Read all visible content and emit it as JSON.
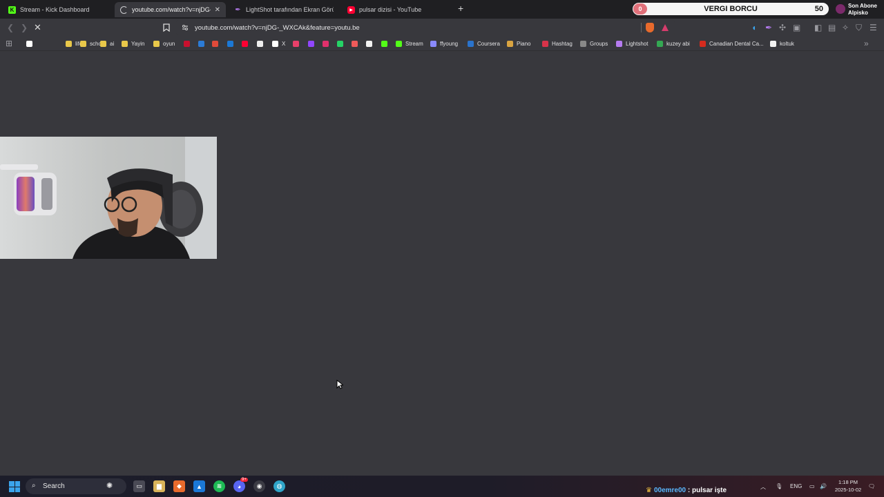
{
  "tabs": [
    {
      "title": "Stream - Kick Dashboard",
      "favicon": "kick-icon",
      "color": "#53fc18"
    },
    {
      "title": "youtube.com/watch?v=njDG-_W",
      "favicon": "loading-icon",
      "color": "#cfcfd2"
    },
    {
      "title": "LightShot tarafından Ekran Görüntüsü",
      "favicon": "lightshot-icon",
      "color": "#b57bf0"
    },
    {
      "title": "pulsar dizisi - YouTube",
      "favicon": "youtube-icon",
      "color": "#ff0033"
    }
  ],
  "new_tab_label": "+",
  "overlay": {
    "vergi_start": "0",
    "vergi_title": "VERGI BORCU",
    "vergi_end": "50",
    "abone_line1": "Son Abone",
    "abone_line2": "Alpisko"
  },
  "address_bar": {
    "url": "youtube.com/watch?v=njDG-_WXCAk&feature=youtu.be"
  },
  "bookmarks": [
    {
      "label": "",
      "icon": "google-icon",
      "color": "#ffffff"
    },
    {
      "label": "life",
      "icon": "folder-icon",
      "color": "#e9c84a"
    },
    {
      "label": "school",
      "icon": "folder-icon",
      "color": "#e9c84a"
    },
    {
      "label": "ai",
      "icon": "folder-icon",
      "color": "#e9c84a"
    },
    {
      "label": "Yayin",
      "icon": "folder-icon",
      "color": "#e9c84a"
    },
    {
      "label": "oyun",
      "icon": "folder-icon",
      "color": "#e9c84a"
    },
    {
      "label": "",
      "icon": "pinterest-icon",
      "color": "#c8102e"
    },
    {
      "label": "",
      "icon": "linkedin-icon",
      "color": "#2b7bd6"
    },
    {
      "label": "",
      "icon": "gmail-icon",
      "color": "#e04a3a"
    },
    {
      "label": "",
      "icon": "outlook-icon",
      "color": "#1b78d6"
    },
    {
      "label": "",
      "icon": "youtube-icon",
      "color": "#ff0033"
    },
    {
      "label": "",
      "icon": "grammarly-icon",
      "color": "#eeeeee"
    },
    {
      "label": "X",
      "icon": "x-icon",
      "color": "#ffffff"
    },
    {
      "label": "",
      "icon": "pocket-icon",
      "color": "#e8406a"
    },
    {
      "label": "",
      "icon": "twitch-icon",
      "color": "#9146ff"
    },
    {
      "label": "",
      "icon": "instagram-icon",
      "color": "#e1306c"
    },
    {
      "label": "",
      "icon": "whatsapp-icon",
      "color": "#25d366"
    },
    {
      "label": "",
      "icon": "tumblr-icon",
      "color": "#ef5a5a"
    },
    {
      "label": "",
      "icon": "amazon-icon",
      "color": "#f2f2f2"
    },
    {
      "label": "",
      "icon": "kick-icon",
      "color": "#53fc18"
    },
    {
      "label": "Stream",
      "icon": "kick-icon",
      "color": "#53fc18"
    },
    {
      "label": "ffyoung",
      "icon": "link-icon",
      "color": "#8a8aff"
    },
    {
      "label": "Coursera",
      "icon": "coursera-icon",
      "color": "#2a73cc"
    },
    {
      "label": "Piano",
      "icon": "piano-icon",
      "color": "#d9a441"
    },
    {
      "label": "Hashtag",
      "icon": "hashtag-icon",
      "color": "#d8334a"
    },
    {
      "label": "Groups",
      "icon": "chain-icon",
      "color": "#888888"
    },
    {
      "label": "Lightshot",
      "icon": "lightshot-icon",
      "color": "#b57bf0"
    },
    {
      "label": "kuzey abi",
      "icon": "drive-icon",
      "color": "#34a853"
    },
    {
      "label": "Canadian Dental Ca...",
      "icon": "maple-icon",
      "color": "#d52b1e"
    },
    {
      "label": "koltuk",
      "icon": "amazon-icon",
      "color": "#f2f2f2"
    }
  ],
  "taskbar": {
    "search_label": "Search",
    "chat_crown": "♛",
    "chat_user": "00emre00",
    "chat_message": " : pulsar işte",
    "lang": "ENG",
    "time": "1:18 PM",
    "date": "2025-10-02",
    "discord_badge": "9+"
  }
}
